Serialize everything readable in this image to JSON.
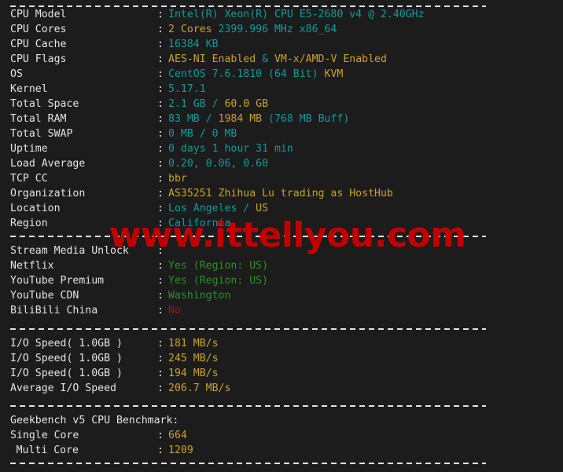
{
  "terminal": {
    "background_color": "#1c1c1c",
    "text_color": "#e3e3e3",
    "colors": {
      "cyan": "#0f9b9b",
      "yellow": "#c9a227",
      "green": "#2f8f2a",
      "red": "#b01010",
      "white": "#e3e3e3",
      "watermark": "#c00000"
    },
    "separator": "--------------------------------------------------------------------------",
    "colon": ":"
  },
  "watermark": {
    "text": "www.ittellyou.com"
  },
  "system_info": [
    {
      "label": "CPU Model",
      "parts": [
        {
          "text": "Intel(R) Xeon(R) CPU E5-2680 v4 @ 2.40GHz",
          "color": "cyan"
        }
      ]
    },
    {
      "label": "CPU Cores",
      "parts": [
        {
          "text": "2 Cores",
          "color": "yellow"
        },
        {
          "text": " 2399.996 MHz x86_64",
          "color": "cyan"
        }
      ]
    },
    {
      "label": "CPU Cache",
      "parts": [
        {
          "text": "16384 KB",
          "color": "cyan"
        }
      ]
    },
    {
      "label": "CPU Flags",
      "parts": [
        {
          "text": "AES-NI Enabled",
          "color": "yellow"
        },
        {
          "text": " & ",
          "color": "cyan"
        },
        {
          "text": "VM-x/AMD-V Enabled",
          "color": "yellow"
        }
      ]
    },
    {
      "label": "OS",
      "parts": [
        {
          "text": "CentOS 7.6.1810 (64 Bit) ",
          "color": "cyan"
        },
        {
          "text": "KVM",
          "color": "yellow"
        }
      ]
    },
    {
      "label": "Kernel",
      "parts": [
        {
          "text": "5.17.1",
          "color": "cyan"
        }
      ]
    },
    {
      "label": "Total Space",
      "parts": [
        {
          "text": "2.1 GB",
          "color": "cyan"
        },
        {
          "text": " / ",
          "color": "cyan"
        },
        {
          "text": "60.0 GB",
          "color": "yellow"
        }
      ]
    },
    {
      "label": "Total RAM",
      "parts": [
        {
          "text": "83 MB",
          "color": "cyan"
        },
        {
          "text": " / ",
          "color": "cyan"
        },
        {
          "text": "1984 MB",
          "color": "yellow"
        },
        {
          "text": " (768 MB Buff)",
          "color": "cyan"
        }
      ]
    },
    {
      "label": "Total SWAP",
      "parts": [
        {
          "text": "0 MB / 0 MB",
          "color": "cyan"
        }
      ]
    },
    {
      "label": "Uptime",
      "parts": [
        {
          "text": "0 days 1 hour 31 min",
          "color": "cyan"
        }
      ]
    },
    {
      "label": "Load Average",
      "parts": [
        {
          "text": "0.20, 0.06, 0.60",
          "color": "cyan"
        }
      ]
    },
    {
      "label": "TCP CC",
      "parts": [
        {
          "text": "bbr",
          "color": "yellow"
        }
      ]
    },
    {
      "label": "Organization",
      "parts": [
        {
          "text": "AS35251 Zhihua Lu trading as HostHub",
          "color": "yellow"
        }
      ]
    },
    {
      "label": "Location",
      "parts": [
        {
          "text": "Los Angeles",
          "color": "cyan"
        },
        {
          "text": " / ",
          "color": "cyan"
        },
        {
          "text": "US",
          "color": "yellow"
        }
      ]
    },
    {
      "label": "Region",
      "parts": [
        {
          "text": "California",
          "color": "cyan"
        }
      ]
    }
  ],
  "stream_media": {
    "heading": "Stream Media Unlock",
    "rows": [
      {
        "label": "Netflix",
        "parts": [
          {
            "text": "Yes (Region: US)",
            "color": "green"
          }
        ]
      },
      {
        "label": "YouTube Premium",
        "parts": [
          {
            "text": "Yes (Region: US)",
            "color": "green"
          }
        ]
      },
      {
        "label": "YouTube CDN",
        "parts": [
          {
            "text": "Washington",
            "color": "green"
          }
        ]
      },
      {
        "label": "BiliBili China",
        "parts": [
          {
            "text": "No",
            "color": "red"
          }
        ]
      }
    ]
  },
  "io_speed": {
    "rows": [
      {
        "label": "I/O Speed( 1.0GB )",
        "parts": [
          {
            "text": "181 MB/s",
            "color": "yellow"
          }
        ]
      },
      {
        "label": "I/O Speed( 1.0GB )",
        "parts": [
          {
            "text": "245 MB/s",
            "color": "yellow"
          }
        ]
      },
      {
        "label": "I/O Speed( 1.0GB )",
        "parts": [
          {
            "text": "194 MB/s",
            "color": "yellow"
          }
        ]
      },
      {
        "label": "Average I/O Speed",
        "parts": [
          {
            "text": "206.7 MB/s",
            "color": "yellow"
          }
        ]
      }
    ]
  },
  "geekbench": {
    "heading": "Geekbench v5 CPU Benchmark:",
    "rows": [
      {
        "label": "Single Core",
        "parts": [
          {
            "text": "664",
            "color": "yellow"
          }
        ]
      },
      {
        "label": "Multi Core",
        "parts": [
          {
            "text": "1209",
            "color": "yellow"
          }
        ]
      }
    ]
  }
}
